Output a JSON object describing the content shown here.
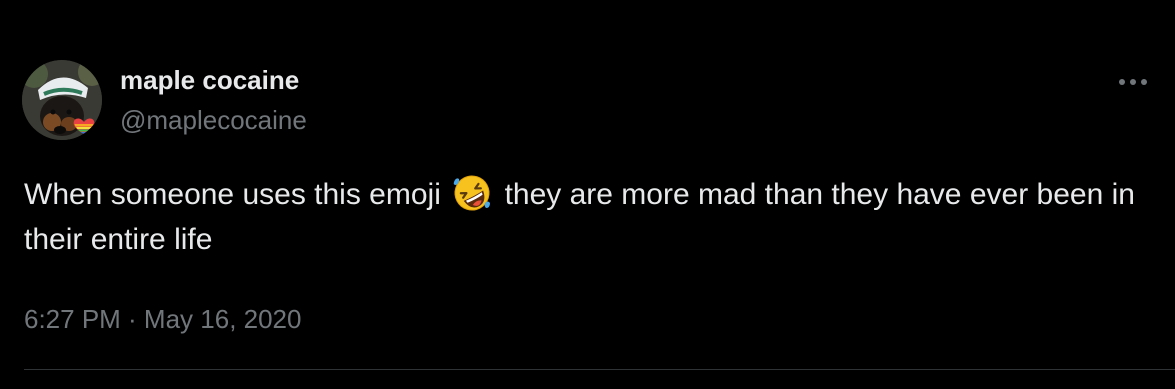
{
  "tweet": {
    "author": {
      "display_name": "maple cocaine",
      "handle": "@maplecocaine",
      "avatar_badge_icon": "rainbow-heart-icon"
    },
    "more_icon": "more-horizontal-icon",
    "text_part1": "When someone uses this emoji",
    "emoji": "rolling-on-floor-laughing-emoji",
    "text_part2": "they are more mad than they have ever been in their entire life",
    "timestamp": "6:27 PM · May 16, 2020"
  },
  "colors": {
    "background": "#000000",
    "primary_text": "#e7e9ea",
    "secondary_text": "#71767b",
    "divider": "#2f3336"
  }
}
